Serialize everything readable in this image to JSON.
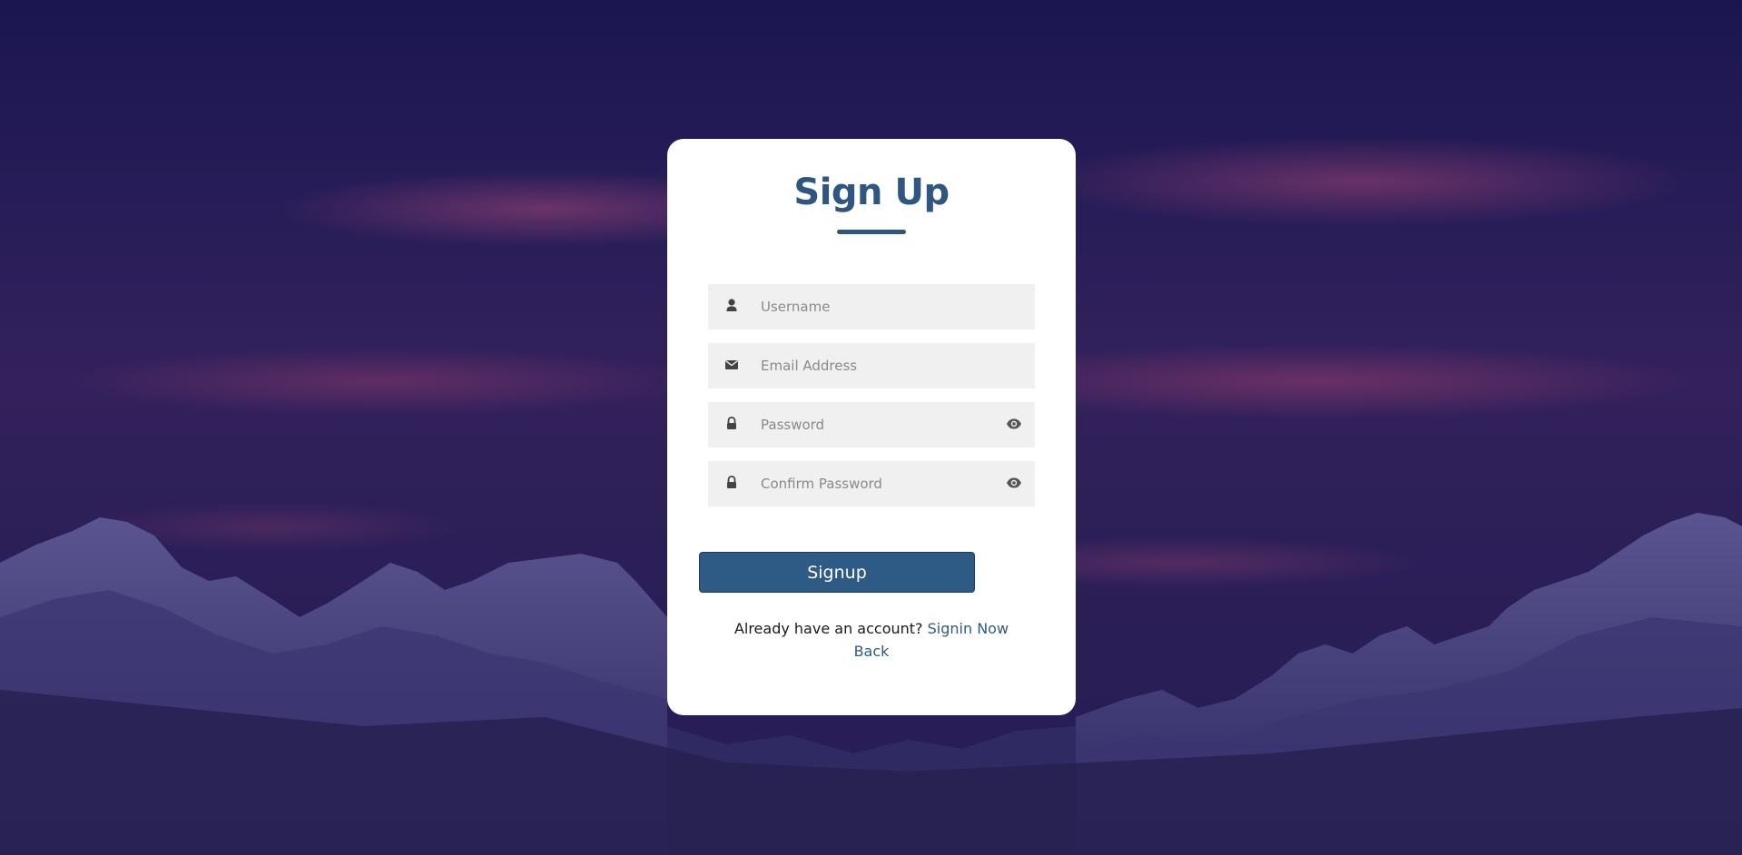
{
  "page": {
    "accent_color": "#2e5680",
    "button_color": "#2e5a86"
  },
  "form": {
    "title": "Sign Up",
    "fields": [
      {
        "name": "username",
        "placeholder": "Username",
        "value": "",
        "icon": "user-icon"
      },
      {
        "name": "email",
        "placeholder": "Email Address",
        "value": "",
        "icon": "envelope-icon"
      },
      {
        "name": "password",
        "placeholder": "Password",
        "value": "",
        "icon": "lock-icon",
        "toggle_icon": "eye-icon"
      },
      {
        "name": "confirm_password",
        "placeholder": "Confirm Password",
        "value": "",
        "icon": "lock-icon",
        "toggle_icon": "eye-icon"
      }
    ],
    "submit_label": "Signup",
    "footer": {
      "prompt": "Already have an account?",
      "signin_link": "Signin Now",
      "back_link": "Back"
    }
  }
}
